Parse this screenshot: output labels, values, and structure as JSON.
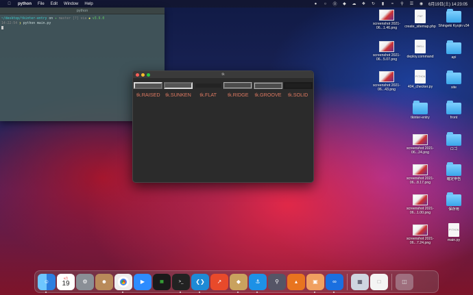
{
  "menubar": {
    "apple_icon": "apple-icon",
    "app_name": "python",
    "menus": [
      "File",
      "Edit",
      "Window",
      "Help"
    ],
    "clock": "6月19日(土)  14:23:05"
  },
  "terminal": {
    "title": "python",
    "prompt_path": "~/desktop/tkinter-entry",
    "prompt_on": " on ",
    "branch": "master",
    "branch_extra": " [?] via ",
    "pyver": "v3.9.0",
    "time": "14:22:54",
    "command": "python main.py"
  },
  "tk": {
    "title": "tk",
    "reliefs": [
      "tk.RAISED",
      "tk.SUNKEN",
      "tk.FLAT",
      "tk.RIDGE",
      "tk.GROOVE",
      "tk.SOLID"
    ]
  },
  "desktop": {
    "items": [
      {
        "label": "screenshot 2021-06...1.46.png",
        "kind": "shot"
      },
      {
        "label": "create_sitemap.php",
        "kind": "doc"
      },
      {
        "label": "Shingeki Kyojin v34",
        "kind": "folder"
      },
      {
        "label": "screenshot 2021-06...5.07.png",
        "kind": "shot"
      },
      {
        "label": "deploy.command",
        "kind": "doc"
      },
      {
        "label": "api",
        "kind": "folder"
      },
      {
        "label": "screenshot 2021-06...43.png",
        "kind": "shot"
      },
      {
        "label": "404_checker.py",
        "kind": "doc"
      },
      {
        "label": "site",
        "kind": "folder"
      },
      {
        "label": "tkinter-entry",
        "kind": "folder"
      },
      {
        "label": "front",
        "kind": "folder"
      },
      {
        "label": "screenshot 2021-06...24.png",
        "kind": "shot"
      },
      {
        "label": "ロゴ",
        "kind": "folder"
      },
      {
        "label": "screenshot 2021-06...8.17.png",
        "kind": "shot"
      },
      {
        "label": "確定申告",
        "kind": "folder"
      },
      {
        "label": "screenshot 2021-06...1.00.png",
        "kind": "shot"
      },
      {
        "label": "保存用",
        "kind": "folder"
      },
      {
        "label": "screenshot 2021-06...7.24.png",
        "kind": "shot"
      },
      {
        "label": "main.py",
        "kind": "doc"
      }
    ]
  },
  "dock": {
    "calendar_day": "19",
    "calendar_month": "6月",
    "apps": [
      "finder",
      "calendar",
      "system-preferences",
      "contacts",
      "chrome",
      "zoom",
      "activity-monitor",
      "terminal",
      "vscode",
      "instruments",
      "python-launcher",
      "docker",
      "quicktime",
      "sourcetree",
      "preview",
      "infinity"
    ],
    "colors": {
      "finder": "#3a8ee6",
      "chrome": "#e5e5e5",
      "zoom": "#2d8cff",
      "vscode": "#1e8ad6",
      "docker": "#1d91e6"
    }
  }
}
